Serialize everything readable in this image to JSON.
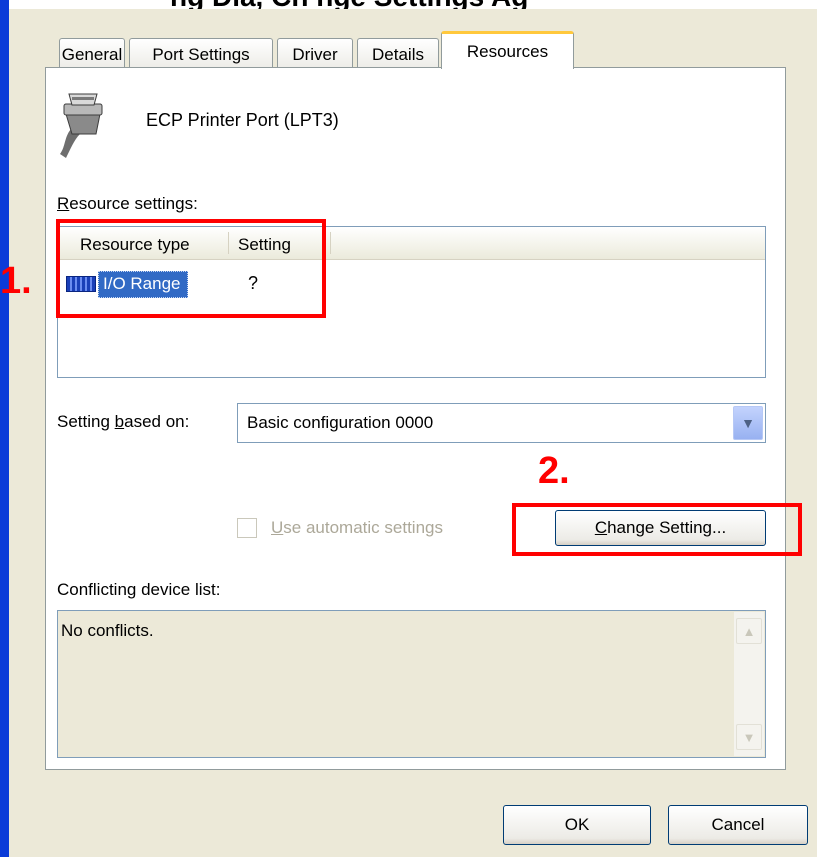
{
  "window": {
    "partial_title": "ng Dia, Ch nge Settings Ag"
  },
  "tabs": [
    {
      "label": "General",
      "active": false
    },
    {
      "label": "Port Settings",
      "active": false
    },
    {
      "label": "Driver",
      "active": false
    },
    {
      "label": "Details",
      "active": false
    },
    {
      "label": "Resources",
      "active": true
    }
  ],
  "device": {
    "name": "ECP Printer Port (LPT3)",
    "icon": "serial-port-connector-icon"
  },
  "resource_settings": {
    "label": "Resource settings:",
    "columns": [
      "Resource type",
      "Setting"
    ],
    "rows": [
      {
        "type": "I/O Range",
        "setting": "?",
        "icon": "chip-icon"
      }
    ]
  },
  "setting_based_on": {
    "label_pre": "Setting ",
    "label_u": "b",
    "label_post": "ased on:",
    "value": "Basic configuration 0000"
  },
  "automatic": {
    "label_u": "U",
    "label_rest": "se automatic settings",
    "checked": false,
    "enabled": false
  },
  "change_setting": {
    "label_u": "C",
    "label_rest": "hange Setting..."
  },
  "conflicts": {
    "label": "Conflicting device list:",
    "text": "No conflicts."
  },
  "buttons": {
    "ok": "OK",
    "cancel": "Cancel"
  },
  "annotations": {
    "step1": "1.",
    "step2": "2."
  },
  "colors": {
    "highlight": "#ff0000",
    "selection": "#316ac5",
    "window_edge": "#0b3bd8"
  }
}
